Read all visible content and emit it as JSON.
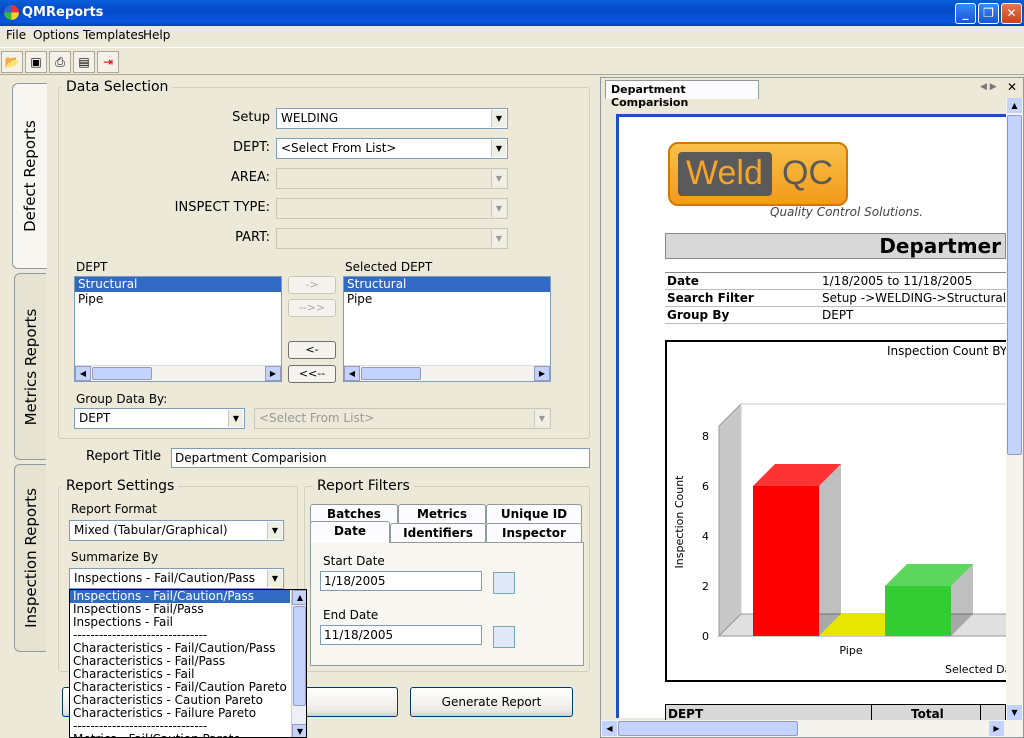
{
  "app": {
    "title": "QMReports"
  },
  "menu": [
    "File",
    "Options",
    "Templates",
    "Help"
  ],
  "toolbar": {
    "icons": [
      "open-icon",
      "save-icon",
      "print-icon",
      "preview-icon",
      "exit-icon"
    ]
  },
  "sidetabs": [
    "Defect Reports",
    "Metrics Reports",
    "Inspection Reports"
  ],
  "data_selection": {
    "title": "Data Selection",
    "setup_label": "Setup",
    "setup_value": "WELDING",
    "dept_label": "DEPT:",
    "dept_value": "<Select From List>",
    "area_label": "AREA:",
    "inspect_type_label": "INSPECT TYPE:",
    "part_label": "PART:",
    "dept_list_label": "DEPT",
    "dept_list": [
      "Structural",
      "Pipe"
    ],
    "selected_list_label": "Selected DEPT",
    "selected_list": [
      "Structural",
      "Pipe"
    ],
    "move_buttons": [
      "->",
      "-->>",
      "<-",
      "<<--"
    ],
    "group_by_label": "Group Data By:",
    "group_by_value": "DEPT",
    "group_by_2": "<Select From List>"
  },
  "report_title": {
    "label": "Report Title",
    "value": "Department Comparision"
  },
  "report_settings": {
    "title": "Report Settings",
    "format_label": "Report Format",
    "format_value": "Mixed (Tabular/Graphical)",
    "summarize_label": "Summarize By",
    "summarize_value": "Inspections - Fail/Caution/Pass",
    "options": [
      "Inspections - Fail/Caution/Pass",
      "Inspections - Fail/Pass",
      "Inspections - Fail",
      "-------------------------------",
      "Characteristics - Fail/Caution/Pass",
      "Characteristics - Fail/Pass",
      "Characteristics - Fail",
      "Characteristics - Fail/Caution Pareto",
      "Characteristics - Caution Pareto",
      "Characteristics - Failure Pareto",
      "-------------------------------",
      "Metrics - Fail/Caution Pareto"
    ]
  },
  "report_filters": {
    "title": "Report Filters",
    "tabs_row1": [
      "Batches",
      "Metrics",
      "Unique ID"
    ],
    "tabs_row2": [
      "Date",
      "Identifiers",
      "Inspector"
    ],
    "start_label": "Start Date",
    "start_value": "1/18/2005",
    "end_label": "End Date",
    "end_value": "11/18/2005"
  },
  "buttons": {
    "report_options": "rt Options",
    "generate": "Generate Report"
  },
  "preview": {
    "tab": "Department Comparision",
    "logo_weld": "Weld",
    "logo_qc": "QC",
    "logo_tagline": "Quality Control Solutions.",
    "heading": "Departmer",
    "rows": [
      {
        "k": "Date",
        "v": "1/18/2005 to 11/18/2005"
      },
      {
        "k": "Search Filter",
        "v": "Setup ->WELDING->Structural,Pip"
      },
      {
        "k": "Group By",
        "v": "DEPT"
      }
    ],
    "table_headers": [
      "DEPT",
      "Total"
    ]
  },
  "chart_data": {
    "type": "bar",
    "title": "Inspection Count BY S",
    "ylabel": "Inspection Count",
    "xlabel": "Selected Da",
    "categories": [
      "Pipe"
    ],
    "ylim": [
      0,
      8
    ],
    "yticks": [
      0,
      2,
      4,
      6,
      8
    ],
    "series": [
      {
        "values": [
          6
        ],
        "color": "#ff0000"
      },
      {
        "values": [
          0
        ],
        "color": "#e6e600"
      },
      {
        "values": [
          2
        ],
        "color": "#33cc33"
      }
    ]
  }
}
